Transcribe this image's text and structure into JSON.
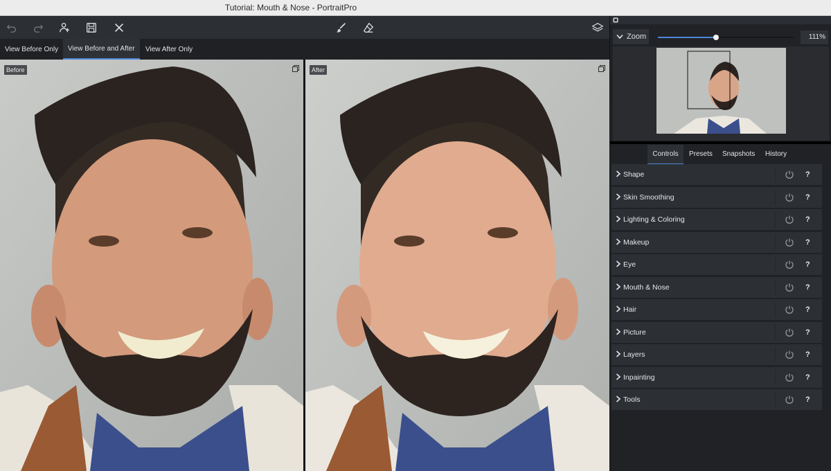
{
  "window": {
    "title": "Tutorial: Mouth & Nose - PortraitPro"
  },
  "toolbar": {
    "left_icons": [
      "undo-icon",
      "redo-icon",
      "add-person-icon",
      "save-icon",
      "close-icon"
    ],
    "center_icons": [
      "brush-icon",
      "eraser-icon"
    ],
    "right_icons": [
      "layers-icon"
    ]
  },
  "view_tabs": [
    {
      "label": "View Before Only",
      "active": false
    },
    {
      "label": "View Before and After",
      "active": true
    },
    {
      "label": "View After Only",
      "active": false
    }
  ],
  "panes": {
    "before_label": "Before",
    "after_label": "After"
  },
  "zoom": {
    "label": "Zoom",
    "value": "111%",
    "slider_fraction": 0.43
  },
  "control_tabs": [
    {
      "label": "Controls",
      "active": true
    },
    {
      "label": "Presets",
      "active": false
    },
    {
      "label": "Snapshots",
      "active": false
    },
    {
      "label": "History",
      "active": false
    }
  ],
  "controls": [
    {
      "label": "Shape"
    },
    {
      "label": "Skin Smoothing"
    },
    {
      "label": "Lighting & Coloring"
    },
    {
      "label": "Makeup"
    },
    {
      "label": "Eye"
    },
    {
      "label": "Mouth & Nose"
    },
    {
      "label": "Hair"
    },
    {
      "label": "Picture"
    },
    {
      "label": "Layers"
    },
    {
      "label": "Inpainting"
    },
    {
      "label": "Tools"
    }
  ],
  "help_glyph": "?",
  "colors": {
    "accent": "#4e86d8",
    "panel": "#2c2f33",
    "background": "#202226"
  }
}
